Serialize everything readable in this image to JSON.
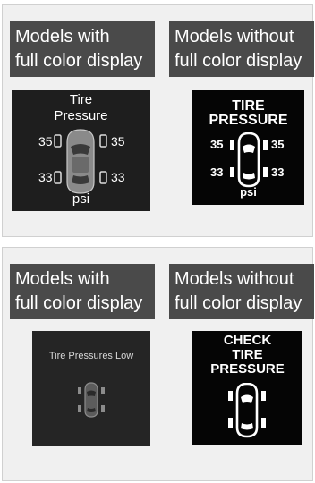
{
  "top_panel": {
    "left_header": {
      "line1": "Models with",
      "line2": "full color display"
    },
    "right_header": {
      "line1": "Models without",
      "line2": "full color display"
    },
    "color_screen": {
      "title_line1": "Tire",
      "title_line2": "Pressure",
      "front_left": "35",
      "front_right": "35",
      "rear_left": "33",
      "rear_right": "33",
      "unit": "psi"
    },
    "mono_screen": {
      "title_line1": "TIRE",
      "title_line2": "PRESSURE",
      "front_left": "35",
      "front_right": "35",
      "rear_left": "33",
      "rear_right": "33",
      "unit": "psi"
    }
  },
  "bottom_panel": {
    "left_header": {
      "line1": "Models with",
      "line2": "full color display"
    },
    "right_header": {
      "line1": "Models without",
      "line2": "full color display"
    },
    "color_screen": {
      "message": "Tire Pressures Low"
    },
    "mono_screen": {
      "line1": "CHECK",
      "line2": "TIRE",
      "line3": "PRESSURE"
    }
  }
}
